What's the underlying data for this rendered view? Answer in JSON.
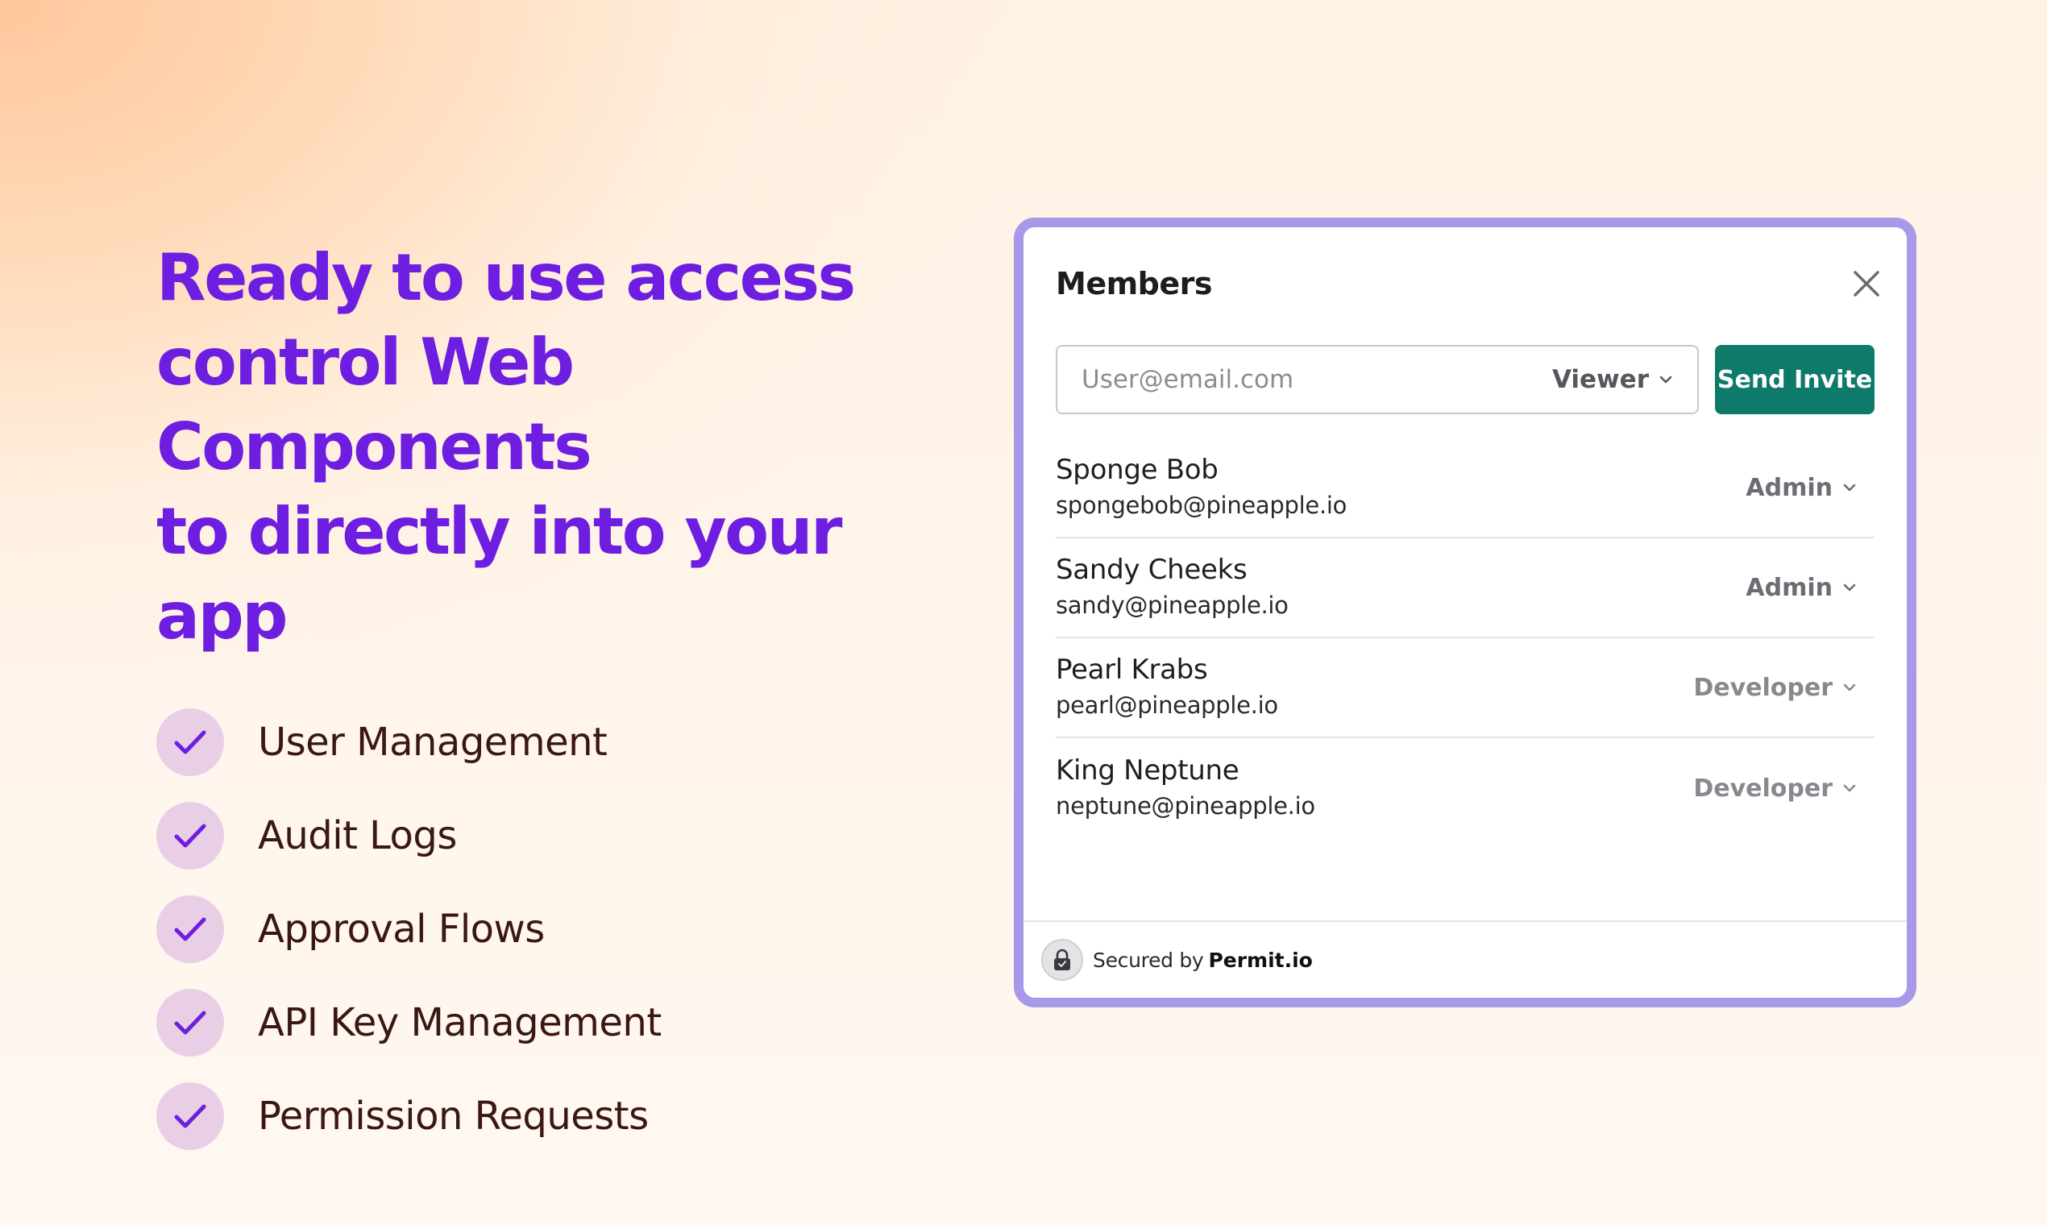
{
  "hero": {
    "title_lines": [
      "Ready to use access",
      "control Web Components",
      "to directly into your app"
    ],
    "features": [
      "User Management",
      "Audit Logs",
      "Approval Flows",
      "API Key Management",
      "Permission Requests"
    ]
  },
  "card": {
    "title": "Members",
    "invite": {
      "placeholder": "User@email.com",
      "value": "",
      "role": "Viewer",
      "send_label": "Send Invite"
    },
    "members": [
      {
        "name": "Sponge Bob",
        "email": "spongebob@pineapple.io",
        "role": "Admin"
      },
      {
        "name": "Sandy Cheeks",
        "email": "sandy@pineapple.io",
        "role": "Admin"
      },
      {
        "name": "Pearl Krabs",
        "email": "pearl@pineapple.io",
        "role": "Developer"
      },
      {
        "name": "King Neptune",
        "email": "neptune@pineapple.io",
        "role": "Developer"
      }
    ],
    "footer": {
      "secured_by": "Secured by",
      "brand": "Permit.io"
    }
  },
  "icons": {
    "check": "check-icon",
    "close": "close-icon",
    "chevron": "chevron-down-icon",
    "lock": "lock-icon"
  },
  "colors": {
    "accent_purple": "#6e1ee0",
    "card_border": "#a898e8",
    "send_button": "#0e7a6a",
    "check_bg": "#e8cfe6"
  }
}
